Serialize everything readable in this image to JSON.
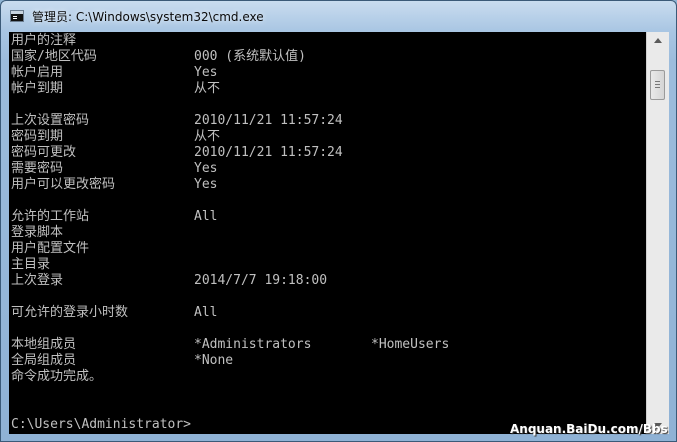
{
  "window": {
    "title": "管理员: C:\\Windows\\system32\\cmd.exe",
    "icon": "console-icon"
  },
  "terminal": {
    "lines": [
      {
        "label": "用户的注释",
        "value": "",
        "value2": ""
      },
      {
        "label": "国家/地区代码",
        "value": "000 (系统默认值)",
        "value2": ""
      },
      {
        "label": "帐户启用",
        "value": "Yes",
        "value2": ""
      },
      {
        "label": "帐户到期",
        "value": "从不",
        "value2": ""
      },
      {
        "label": "",
        "value": "",
        "value2": ""
      },
      {
        "label": "上次设置密码",
        "value": "2010/11/21 11:57:24",
        "value2": ""
      },
      {
        "label": "密码到期",
        "value": "从不",
        "value2": ""
      },
      {
        "label": "密码可更改",
        "value": "2010/11/21 11:57:24",
        "value2": ""
      },
      {
        "label": "需要密码",
        "value": "Yes",
        "value2": ""
      },
      {
        "label": "用户可以更改密码",
        "value": "Yes",
        "value2": ""
      },
      {
        "label": "",
        "value": "",
        "value2": ""
      },
      {
        "label": "允许的工作站",
        "value": "All",
        "value2": ""
      },
      {
        "label": "登录脚本",
        "value": "",
        "value2": ""
      },
      {
        "label": "用户配置文件",
        "value": "",
        "value2": ""
      },
      {
        "label": "主目录",
        "value": "",
        "value2": ""
      },
      {
        "label": "上次登录",
        "value": "2014/7/7 19:18:00",
        "value2": ""
      },
      {
        "label": "",
        "value": "",
        "value2": ""
      },
      {
        "label": "可允许的登录小时数",
        "value": "All",
        "value2": ""
      },
      {
        "label": "",
        "value": "",
        "value2": ""
      },
      {
        "label": "本地组成员",
        "value": "*Administrators",
        "value2": "*HomeUsers"
      },
      {
        "label": "全局组成员",
        "value": "*None",
        "value2": ""
      },
      {
        "label": "命令成功完成。",
        "value": "",
        "value2": ""
      },
      {
        "label": "",
        "value": "",
        "value2": ""
      },
      {
        "label": "",
        "value": "",
        "value2": ""
      },
      {
        "label": "C:\\Users\\Administrator>",
        "value": "",
        "value2": ""
      }
    ]
  },
  "watermark": "Anquan.BaiDu.com/Bbs",
  "colors": {
    "terminal_bg": "#000000",
    "terminal_fg": "#c0c0c0",
    "titlebar": "#a9c6e3"
  }
}
